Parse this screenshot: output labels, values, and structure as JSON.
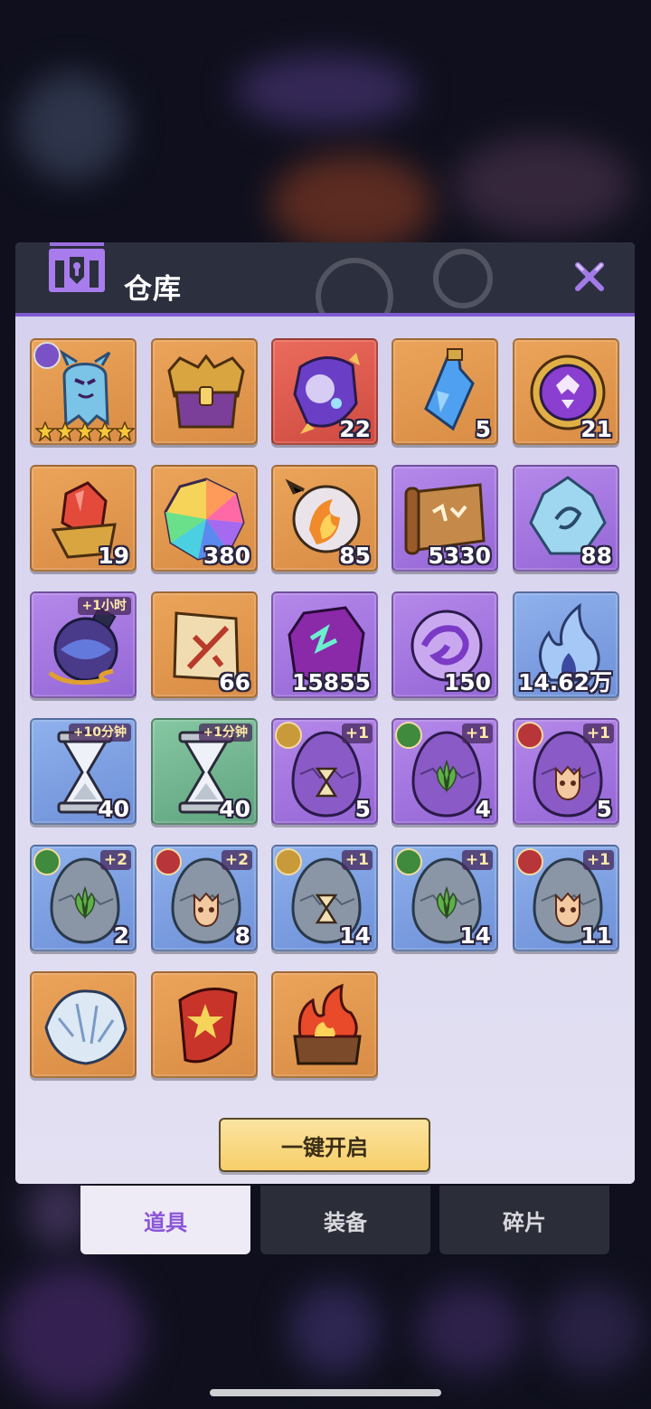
{
  "dialog": {
    "title": "仓库",
    "close_icon": "close-x-icon",
    "header_icon": "treasure-chest-icon",
    "open_all_label": "一键开启"
  },
  "items": [
    {
      "name": "hero-card",
      "bg": "orange",
      "icon": "blue-ghost-hero",
      "qty": "",
      "stars": 5,
      "badge": "hero"
    },
    {
      "name": "golden-chest",
      "bg": "orange",
      "icon": "ornate-chest",
      "qty": ""
    },
    {
      "name": "cosmic-gem",
      "bg": "red",
      "icon": "galaxy-gem",
      "qty": "22"
    },
    {
      "name": "blue-potion",
      "bg": "orange",
      "icon": "blue-potion",
      "qty": "5"
    },
    {
      "name": "purple-medallion",
      "bg": "orange",
      "icon": "purple-medallion",
      "qty": "21"
    },
    {
      "name": "red-crystal",
      "bg": "orange",
      "icon": "red-crystal",
      "qty": "19"
    },
    {
      "name": "rainbow-gem",
      "bg": "orange",
      "icon": "rainbow-gem",
      "qty": "380"
    },
    {
      "name": "fire-orb",
      "bg": "orange",
      "icon": "fire-orb",
      "qty": "85"
    },
    {
      "name": "scroll-map",
      "bg": "purple",
      "icon": "scroll",
      "qty": "5330"
    },
    {
      "name": "ice-crystal",
      "bg": "purple",
      "icon": "ice-crystal",
      "qty": "88"
    },
    {
      "name": "time-potion",
      "bg": "purple",
      "icon": "dark-potion",
      "qty": "",
      "tag": "+1小时"
    },
    {
      "name": "sword-scroll",
      "bg": "orange",
      "icon": "sword-scroll",
      "qty": "66"
    },
    {
      "name": "rune-stone",
      "bg": "purple",
      "icon": "rune-stone",
      "qty": "15855"
    },
    {
      "name": "purple-orb",
      "bg": "purple",
      "icon": "purple-orb",
      "qty": "150"
    },
    {
      "name": "blue-flame",
      "bg": "blue",
      "icon": "blue-flame",
      "qty": "14.62万"
    },
    {
      "name": "hourglass-10m",
      "bg": "blue",
      "icon": "hourglass",
      "qty": "40",
      "tag": "+10分钟"
    },
    {
      "name": "hourglass-1m",
      "bg": "green",
      "icon": "hourglass",
      "qty": "40",
      "tag": "+1分钟"
    },
    {
      "name": "purple-egg-gold",
      "bg": "purple",
      "icon": "egg-purple",
      "qty": "5",
      "badge": "gold",
      "tag": "+1",
      "emblem": "hourglass"
    },
    {
      "name": "purple-egg-leaf",
      "bg": "purple",
      "icon": "egg-purple",
      "qty": "4",
      "badge": "leaf",
      "tag": "+1",
      "emblem": "leaf"
    },
    {
      "name": "purple-egg-skull",
      "bg": "purple",
      "icon": "egg-purple",
      "qty": "5",
      "badge": "skull",
      "tag": "+1",
      "emblem": "skull"
    },
    {
      "name": "gray-egg-leaf-2",
      "bg": "blue",
      "icon": "egg-gray",
      "qty": "2",
      "badge": "leaf",
      "tag": "+2",
      "emblem": "leaf"
    },
    {
      "name": "gray-egg-skull-2",
      "bg": "blue",
      "icon": "egg-gray",
      "qty": "8",
      "badge": "skull",
      "tag": "+2",
      "emblem": "skull"
    },
    {
      "name": "gray-egg-gold",
      "bg": "blue",
      "icon": "egg-gray",
      "qty": "14",
      "badge": "gold",
      "tag": "+1",
      "emblem": "hourglass"
    },
    {
      "name": "gray-egg-leaf",
      "bg": "blue",
      "icon": "egg-gray",
      "qty": "14",
      "badge": "leaf",
      "tag": "+1",
      "emblem": "leaf"
    },
    {
      "name": "gray-egg-skull",
      "bg": "blue",
      "icon": "egg-gray",
      "qty": "11",
      "badge": "skull",
      "tag": "+1",
      "emblem": "skull"
    },
    {
      "name": "feather-bundle",
      "bg": "orange",
      "icon": "white-feathers",
      "qty": ""
    },
    {
      "name": "star-shield",
      "bg": "orange",
      "icon": "red-shield",
      "qty": ""
    },
    {
      "name": "flame-chest",
      "bg": "orange",
      "icon": "fire-chest",
      "qty": ""
    }
  ],
  "tabs": [
    {
      "label": "道具",
      "active": true
    },
    {
      "label": "装备",
      "active": false
    },
    {
      "label": "碎片",
      "active": false
    }
  ],
  "colors": {
    "accent": "#7d5ad2",
    "button": "#f7cf69",
    "active_tab_text": "#8a55d6"
  }
}
